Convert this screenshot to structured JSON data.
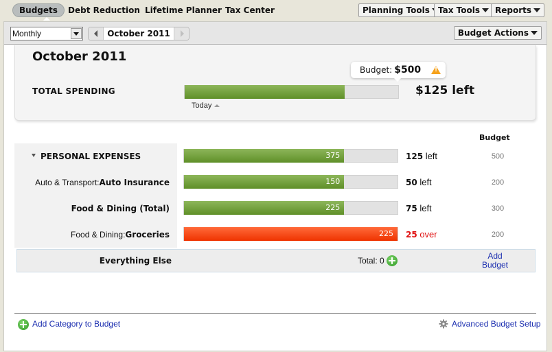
{
  "nav": {
    "tabs": [
      {
        "label": "Budgets",
        "active": true
      },
      {
        "label": "Debt Reduction"
      },
      {
        "label": "Lifetime Planner"
      },
      {
        "label": "Tax Center"
      }
    ],
    "tools": [
      {
        "label": "Planning Tools"
      },
      {
        "label": "Tax Tools"
      },
      {
        "label": "Reports"
      }
    ]
  },
  "toolbar": {
    "period_select": "Monthly",
    "current_month": "October 2011",
    "actions_label": "Budget Actions"
  },
  "summary": {
    "title": "October 2011",
    "total_label": "TOTAL SPENDING",
    "spent": 375,
    "budget_label": "Budget:",
    "budget_amount": "$500",
    "left_text": "$125 left",
    "today_label": "Today",
    "progress": 0.75,
    "colors": {
      "green": "#6b9a35",
      "over": "#f23c0a",
      "warning": "#f6a21c"
    }
  },
  "table": {
    "budget_header": "Budget",
    "rows": [
      {
        "prefix": "",
        "name": "PERSONAL EXPENSES",
        "group": true,
        "spent": "375",
        "progress": 0.75,
        "remaining": "125",
        "status_word": "left",
        "over": false,
        "budget": "500"
      },
      {
        "prefix": "Auto & Transport:",
        "name": "Auto Insurance",
        "group": false,
        "spent": "150",
        "progress": 0.75,
        "remaining": "50",
        "status_word": "left",
        "over": false,
        "budget": "200"
      },
      {
        "prefix": "",
        "name": "Food & Dining (Total)",
        "group": false,
        "spent": "225",
        "progress": 0.75,
        "remaining": "75",
        "status_word": "left",
        "over": false,
        "budget": "300"
      },
      {
        "prefix": "Food & Dining:",
        "name": "Groceries",
        "group": false,
        "spent": "225",
        "progress": 1.0,
        "remaining": "25",
        "status_word": "over",
        "over": true,
        "budget": "200"
      }
    ],
    "everything_else": {
      "label": "Everything Else",
      "total": "Total: 0",
      "add_budget_line1": "Add",
      "add_budget_line2": "Budget"
    }
  },
  "footer": {
    "add_category": "Add Category to Budget",
    "advanced_setup": "Advanced Budget Setup"
  }
}
